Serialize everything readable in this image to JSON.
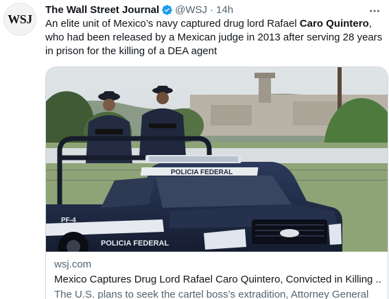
{
  "author": {
    "avatar_text": "WSJ",
    "name": "The Wall Street Journal",
    "handle": "@WSJ",
    "separator": "·",
    "time": "14h"
  },
  "tweet": {
    "text_before": "An elite unit of Mexico’s navy captured drug lord Rafael ",
    "text_bold": "Caro Quintero",
    "text_after": ", who had been released by a Mexican judge in 2013 after serving 28 years in prison for the killing of a DEA agent"
  },
  "card": {
    "image_text": {
      "roof": "POLICIA FEDERAL",
      "door": "POLICIA FEDERAL",
      "plate": "PF-4"
    },
    "domain": "wsj.com",
    "title": "Mexico Captures Drug Lord Rafael Caro Quintero, Convicted in Killing ...",
    "description": "The U.S. plans to seek the cartel boss’s extradition, Attorney General"
  },
  "icons": {
    "verified": "verified-badge-icon",
    "more": "more-options-icon"
  },
  "colors": {
    "verified": "#1d9bf0",
    "secondary_text": "#536471",
    "border": "#cfd9de",
    "truck": "#1e2a44"
  }
}
